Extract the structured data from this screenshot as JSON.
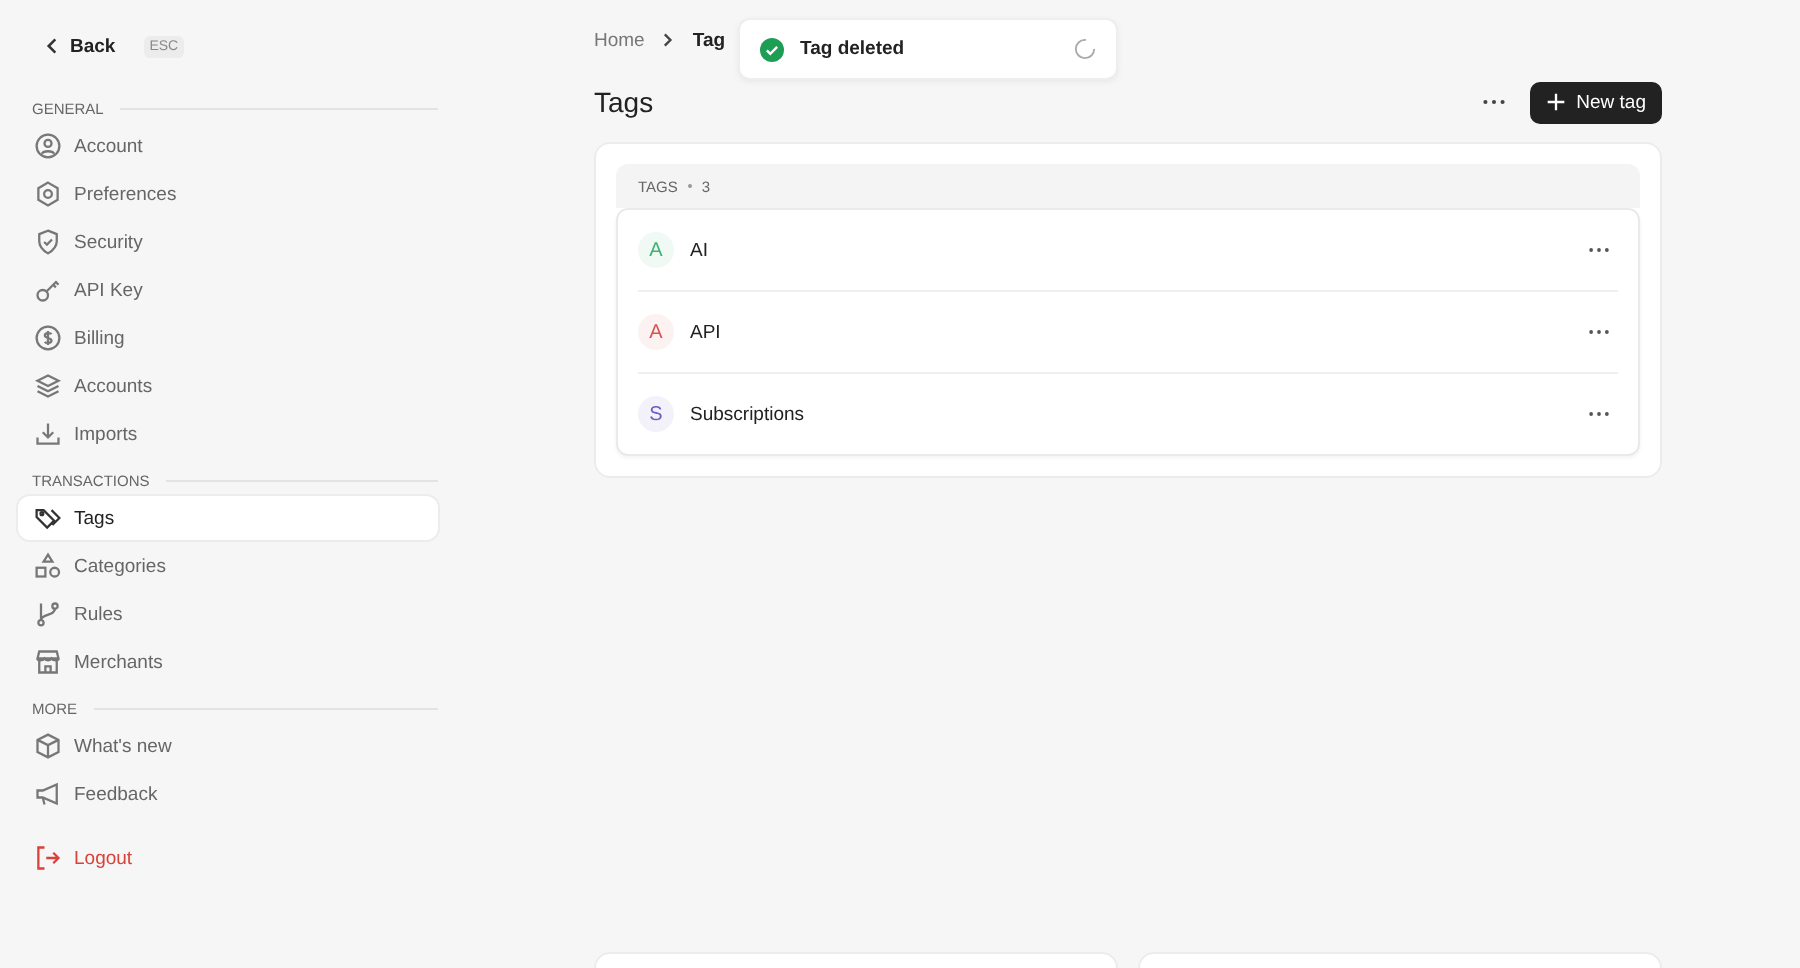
{
  "back": {
    "label": "Back",
    "shortcut": "ESC"
  },
  "sidebar": {
    "sections": [
      {
        "title": "GENERAL",
        "items": [
          {
            "label": "Account",
            "selected": false
          },
          {
            "label": "Preferences",
            "selected": false
          },
          {
            "label": "Security",
            "selected": false
          },
          {
            "label": "API Key",
            "selected": false
          },
          {
            "label": "Billing",
            "selected": false
          },
          {
            "label": "Accounts",
            "selected": false
          },
          {
            "label": "Imports",
            "selected": false
          }
        ]
      },
      {
        "title": "TRANSACTIONS",
        "items": [
          {
            "label": "Tags",
            "selected": true
          },
          {
            "label": "Categories",
            "selected": false
          },
          {
            "label": "Rules",
            "selected": false
          },
          {
            "label": "Merchants",
            "selected": false
          }
        ]
      },
      {
        "title": "MORE",
        "items": [
          {
            "label": "What's new",
            "selected": false
          },
          {
            "label": "Feedback",
            "selected": false
          }
        ]
      }
    ],
    "logout": "Logout"
  },
  "breadcrumb": [
    "Home",
    "Tag"
  ],
  "toast": {
    "message": "Tag deleted"
  },
  "page_title": "Tags",
  "new_button": "New tag",
  "tags": {
    "header": "TAGS",
    "count": "3",
    "items": [
      {
        "initial": "A",
        "name": "AI",
        "color": "#3cb371"
      },
      {
        "initial": "A",
        "name": "API",
        "color": "#d9534f"
      },
      {
        "initial": "S",
        "name": "Subscriptions",
        "color": "#6b5fc7"
      }
    ]
  }
}
